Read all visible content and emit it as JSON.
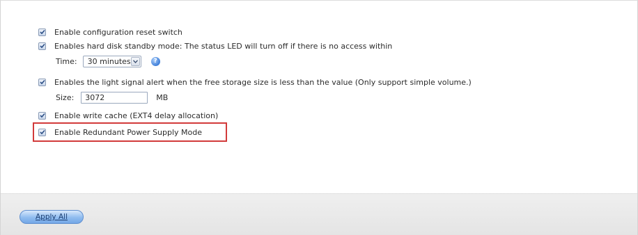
{
  "options": {
    "config_reset": {
      "label": "Enable configuration reset switch",
      "checked": true
    },
    "standby": {
      "label": "Enables hard disk standby mode: The status LED will turn off if there is no access within",
      "checked": true,
      "time_label": "Time:",
      "time_value": "30 minutes"
    },
    "light_alert": {
      "label": "Enables the light signal alert when the free storage size is less than the value (Only support simple volume.)",
      "checked": true,
      "size_label": "Size:",
      "size_value": "3072",
      "size_unit": "MB"
    },
    "write_cache": {
      "label": "Enable write cache (EXT4 delay allocation)",
      "checked": true
    },
    "redundant_power": {
      "label": "Enable Redundant Power Supply Mode",
      "checked": true
    }
  },
  "footer": {
    "apply_label": "Apply All"
  },
  "colors": {
    "highlight": "#d23a3a",
    "button": "#8fbcef"
  }
}
